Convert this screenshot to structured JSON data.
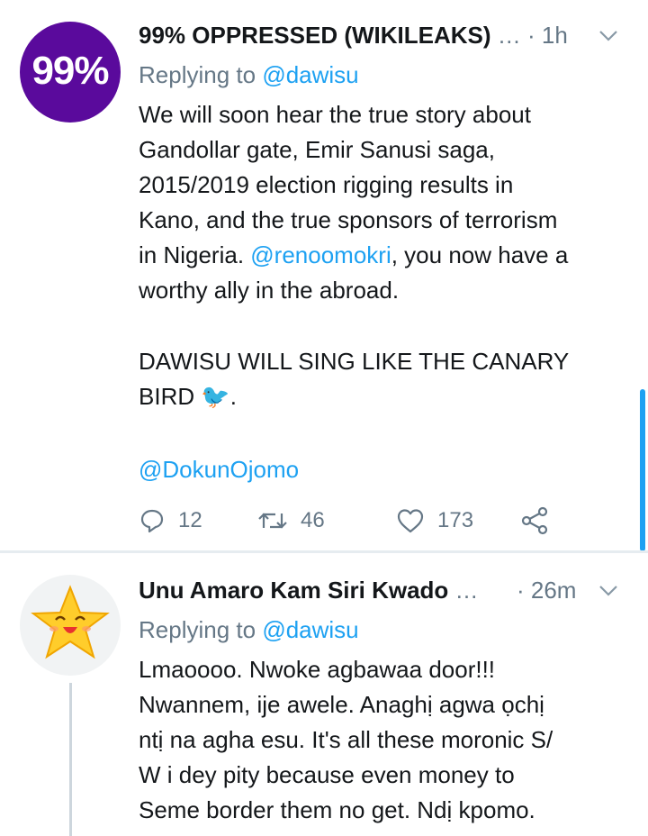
{
  "tweets": [
    {
      "avatar_text": "99%",
      "name": "99% OPPRESSED (WIKILEAKS)",
      "time": "1h",
      "replying_prefix": "Replying to ",
      "replying_handle": "@dawisu",
      "body_part1": "We will soon hear the true story about\nGandollar gate, Emir Sanusi saga,\n2015/2019 election rigging results in\nKano, and the true sponsors of terrorism\nin Nigeria. ",
      "body_mention": "@renoomokri",
      "body_part2": ", you now have a\nworthy ally in the abroad.",
      "body_caps": "DAWISU WILL SING LIKE THE CANARY\nBIRD 🐦.",
      "body_mention2": "@DokunOjomo",
      "replies": "12",
      "retweets": "46",
      "likes": "173"
    },
    {
      "name": "Unu Amaro Kam Siri Kwado",
      "time": "26m",
      "replying_prefix": "Replying to ",
      "replying_handle": "@dawisu",
      "body": "Lmaoooo. Nwoke agbawaa door!!!\nNwannem, ije awele. Anaghị agwa ọchị\nntị na agha esu. It's all these moronic S/\nW i dey pity because even money to\nSeme border them no get. Ndị kpomo."
    }
  ],
  "colors": {
    "accent": "#1da1f2",
    "muted": "#657786",
    "avatar1": "#5a0a9c",
    "star": "#ffcd2b"
  },
  "icons": [
    "reply-icon",
    "retweet-icon",
    "like-icon",
    "share-icon",
    "chevron-down-icon"
  ]
}
